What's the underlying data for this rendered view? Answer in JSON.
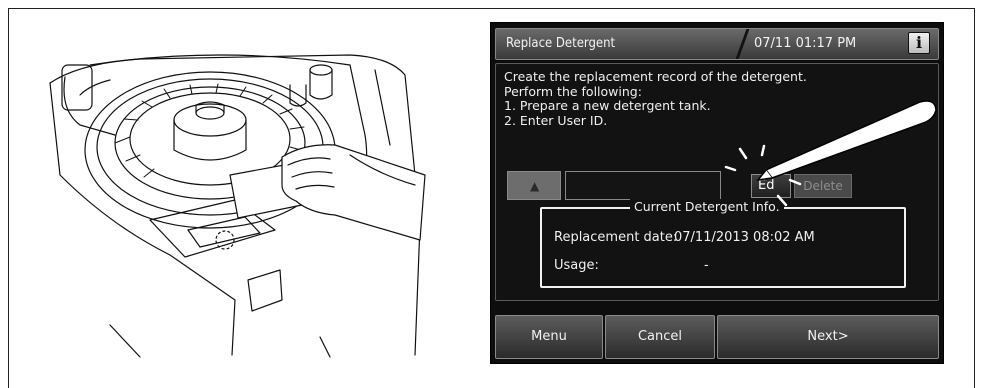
{
  "screen": {
    "title": "Replace Detergent",
    "datetime": "07/11 01:17 PM",
    "info_button_label": "i",
    "instructions": "Create the replacement record of the detergent.\nPerform the following:\n1. Prepare a new detergent tank.\n2. Enter User ID.",
    "user_field": {
      "icon": "user-icon",
      "value": ""
    },
    "edit_button_label": "Ed",
    "delete_button_label": "Delete",
    "info_box": {
      "legend": "Current Detergent Info.",
      "replacement_label": "Replacement date:",
      "replacement_value": "07/11/2013 08:02 AM",
      "usage_label": "Usage:",
      "usage_value": "-"
    },
    "footer": {
      "menu_label": "Menu",
      "cancel_label": "Cancel",
      "next_label": "Next>"
    }
  },
  "colors": {
    "screen_bg": "#0d0d0d",
    "titlebar": "#4a4a4a",
    "text": "#f2f2f2",
    "disabled_text": "#8c8c8c"
  }
}
